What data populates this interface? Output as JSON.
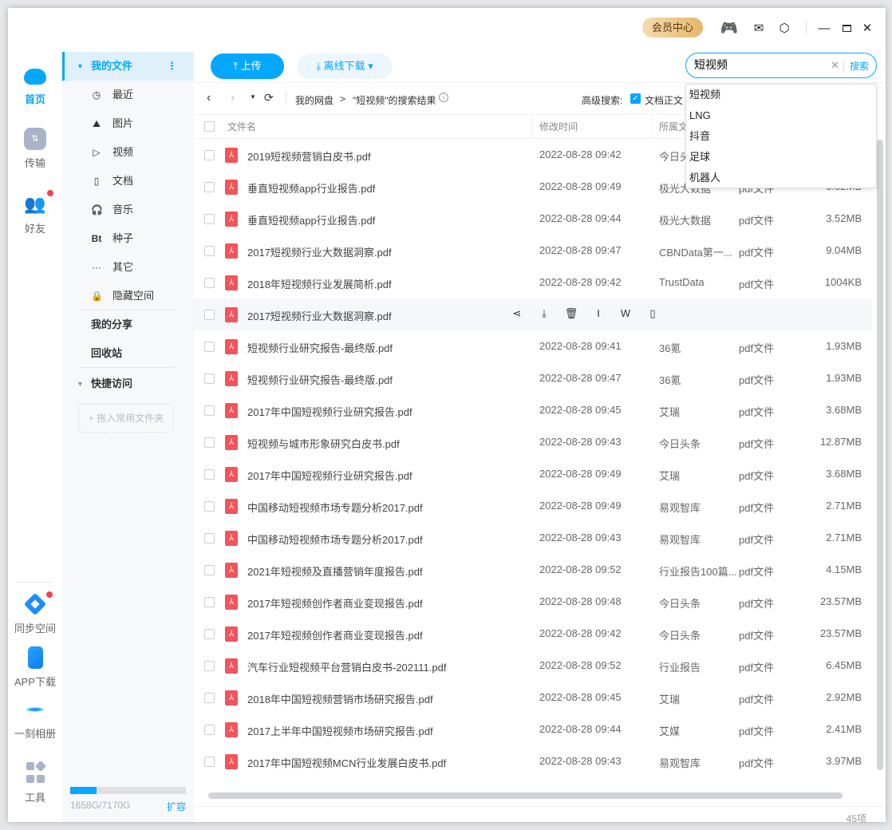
{
  "titlebar": {
    "vip": "会员中心",
    "icons": [
      "game-icon",
      "mail-icon",
      "settings-icon",
      "minimize-icon",
      "maximize-icon",
      "close-icon"
    ]
  },
  "nav": {
    "items": [
      {
        "label": "首页"
      },
      {
        "label": "传输"
      },
      {
        "label": "好友"
      },
      {
        "label": "同步空间"
      },
      {
        "label": "APP下载"
      },
      {
        "label": "一刻相册"
      },
      {
        "label": "工具"
      }
    ]
  },
  "sidebar": {
    "my_files": "我的文件",
    "items": [
      {
        "icon": "◷",
        "label": "最近"
      },
      {
        "icon": "⛰",
        "label": "图片"
      },
      {
        "icon": "▷",
        "label": "视频"
      },
      {
        "icon": "▯",
        "label": "文档"
      },
      {
        "icon": "🎧",
        "label": "音乐"
      },
      {
        "icon": "Bt",
        "label": "种子"
      },
      {
        "icon": "···",
        "label": "其它"
      },
      {
        "icon": "🔒",
        "label": "隐藏空间"
      }
    ],
    "my_share": "我的分享",
    "recycle": "回收站",
    "quick": "快捷访问",
    "drop_hint": "+ 拖入常用文件夹",
    "storage": "1658G/7170G",
    "storage_used": 0.231,
    "expand": "扩容"
  },
  "toolbar": {
    "upload": "上传",
    "offline": "离线下载 ▾"
  },
  "search": {
    "value": "短视频",
    "button": "搜索",
    "suggestions": [
      "短视频",
      "LNG",
      "抖音",
      "足球",
      "机器人"
    ]
  },
  "breadcrumb": {
    "root": "我的网盘",
    "sep": ">",
    "current": "\"短视频\"的搜索结果",
    "adv_label": "高级搜索:",
    "adv_option": "文档正文"
  },
  "table": {
    "headers": {
      "name": "文件名",
      "time": "修改时间",
      "source": "所属文件夹"
    },
    "rows": [
      {
        "name": "2019短视频营销白皮书.pdf",
        "time": "2022-08-28 09:42",
        "src": "今日头条",
        "type": "pdf文件",
        "size": ""
      },
      {
        "name": "垂直短视频app行业报告.pdf",
        "time": "2022-08-28 09:49",
        "src": "极光大数据",
        "type": "pdf文件",
        "size": "3.52MB"
      },
      {
        "name": "垂直短视频app行业报告.pdf",
        "time": "2022-08-28 09:44",
        "src": "极光大数据",
        "type": "pdf文件",
        "size": "3.52MB"
      },
      {
        "name": "2017短视频行业大数据洞察.pdf",
        "time": "2022-08-28 09:47",
        "src": "CBNData第一...",
        "type": "pdf文件",
        "size": "9.04MB"
      },
      {
        "name": "2018年短视频行业发展简析.pdf",
        "time": "2022-08-28 09:42",
        "src": "TrustData",
        "type": "pdf文件",
        "size": "1004KB"
      },
      {
        "name": "2017短视频行业大数据洞察.pdf",
        "time": "",
        "src": "",
        "type": "",
        "size": ""
      },
      {
        "name": "短视频行业研究报告-最终版.pdf",
        "time": "2022-08-28 09:41",
        "src": "36氪",
        "type": "pdf文件",
        "size": "1.93MB"
      },
      {
        "name": "短视频行业研究报告-最终版.pdf",
        "time": "2022-08-28 09:47",
        "src": "36氪",
        "type": "pdf文件",
        "size": "1.93MB"
      },
      {
        "name": "2017年中国短视频行业研究报告.pdf",
        "time": "2022-08-28 09:45",
        "src": "艾瑞",
        "type": "pdf文件",
        "size": "3.68MB"
      },
      {
        "name": "短视频与城市形象研究白皮书.pdf",
        "time": "2022-08-28 09:43",
        "src": "今日头条",
        "type": "pdf文件",
        "size": "12.87MB"
      },
      {
        "name": "2017年中国短视频行业研究报告.pdf",
        "time": "2022-08-28 09:49",
        "src": "艾瑞",
        "type": "pdf文件",
        "size": "3.68MB"
      },
      {
        "name": "中国移动短视频市场专题分析2017.pdf",
        "time": "2022-08-28 09:49",
        "src": "易观智库",
        "type": "pdf文件",
        "size": "2.71MB"
      },
      {
        "name": "中国移动短视频市场专题分析2017.pdf",
        "time": "2022-08-28 09:43",
        "src": "易观智库",
        "type": "pdf文件",
        "size": "2.71MB"
      },
      {
        "name": "2021年短视频及直播营销年度报告.pdf",
        "time": "2022-08-28 09:52",
        "src": "行业报告100篇...",
        "type": "pdf文件",
        "size": "4.15MB"
      },
      {
        "name": "2017年短视频创作者商业变现报告.pdf",
        "time": "2022-08-28 09:48",
        "src": "今日头条",
        "type": "pdf文件",
        "size": "23.57MB"
      },
      {
        "name": "2017年短视频创作者商业变现报告.pdf",
        "time": "2022-08-28 09:42",
        "src": "今日头条",
        "type": "pdf文件",
        "size": "23.57MB"
      },
      {
        "name": "汽车行业短视频平台营销白皮书-202111.pdf",
        "time": "2022-08-28 09:52",
        "src": "行业报告",
        "type": "pdf文件",
        "size": "6.45MB"
      },
      {
        "name": "2018年中国短视频营销市场研究报告.pdf",
        "time": "2022-08-28 09:45",
        "src": "艾瑞",
        "type": "pdf文件",
        "size": "2.92MB"
      },
      {
        "name": "2017上半年中国短视频市场研究报告.pdf",
        "time": "2022-08-28 09:44",
        "src": "艾媒",
        "type": "pdf文件",
        "size": "2.41MB"
      },
      {
        "name": "2017年中国短视频MCN行业发展白皮书.pdf",
        "time": "2022-08-28 09:43",
        "src": "易观智库",
        "type": "pdf文件",
        "size": "3.97MB"
      }
    ]
  },
  "footer": {
    "count": "45项"
  }
}
